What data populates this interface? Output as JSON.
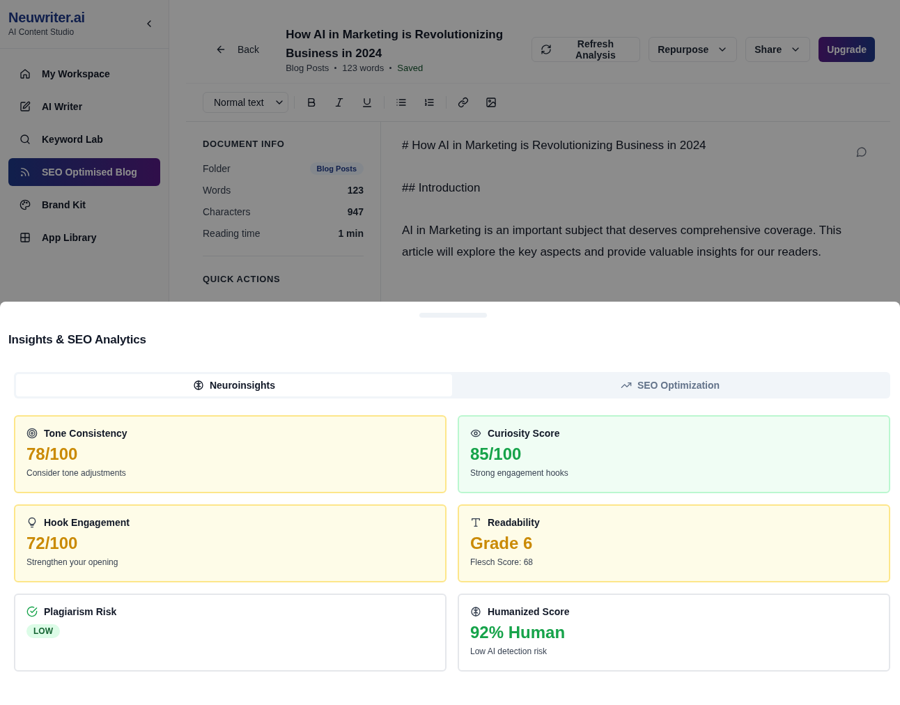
{
  "sidebar": {
    "brand": "Neuwriter.ai",
    "tagline": "AI Content Studio",
    "items": [
      {
        "label": "My Workspace",
        "selected": false
      },
      {
        "label": "AI Writer",
        "selected": false
      },
      {
        "label": "Keyword Lab",
        "selected": false
      },
      {
        "label": "SEO Optimised Blog",
        "selected": true
      },
      {
        "label": "Brand Kit",
        "selected": false
      },
      {
        "label": "App Library",
        "selected": false
      }
    ]
  },
  "header": {
    "back": "Back",
    "title": "How AI in Marketing is Revolutionizing Business in 2024",
    "meta": [
      "Blog Posts",
      "123 words"
    ],
    "save_status": "Saved",
    "actions": [
      {
        "label": "Refresh Analysis",
        "kind": "refresh"
      },
      {
        "label": "Repurpose",
        "kind": "dropdown"
      },
      {
        "label": "Share",
        "kind": "dropdown"
      },
      {
        "label": "Upgrade",
        "kind": "primary"
      }
    ]
  },
  "toolbar": {
    "format": "Normal text"
  },
  "document_info": {
    "heading": "DOCUMENT INFO",
    "rows": [
      {
        "label": "Folder",
        "value": "Blog Posts",
        "kind": "badge"
      },
      {
        "label": "Words",
        "value": "123",
        "kind": "text"
      },
      {
        "label": "Characters",
        "value": "947",
        "kind": "text"
      },
      {
        "label": "Reading time",
        "value": "1 min",
        "kind": "text"
      }
    ]
  },
  "quick_actions": {
    "heading": "QUICK ACTIONS"
  },
  "editor": {
    "lines": [
      "# How AI in Marketing is Revolutionizing Business in 2024",
      "## Introduction",
      "AI in Marketing is an important subject that deserves comprehensive coverage. This article will explore the key aspects and provide valuable insights for our readers."
    ]
  },
  "panel": {
    "title": "Insights & SEO Analytics",
    "tabs": [
      {
        "label": "Neuroinsights",
        "selected": true
      },
      {
        "label": "SEO Optimization",
        "selected": false
      }
    ],
    "cards": [
      {
        "title": "Tone Consistency",
        "kind": "warning",
        "value": "78/100",
        "color": "#ca8a04",
        "note": "Consider tone adjustments"
      },
      {
        "title": "Curiosity Score",
        "kind": "success",
        "value": "85/100",
        "color": "#16a34a",
        "note": "Strong engagement hooks"
      },
      {
        "title": "Hook Engagement",
        "kind": "warning",
        "value": "72/100",
        "color": "#ca8a04",
        "note": "Strengthen your opening"
      },
      {
        "title": "Readability",
        "kind": "warning",
        "value": "Grade 6",
        "color": "#ca8a04",
        "note": "Flesch Score: 68"
      },
      {
        "title": "Plagiarism Risk",
        "kind": "badge",
        "value": "LOW"
      },
      {
        "title": "Humanized Score",
        "kind": "plain",
        "value": "92% Human",
        "color": "#16a34a",
        "note": "Low AI detection risk"
      }
    ]
  }
}
